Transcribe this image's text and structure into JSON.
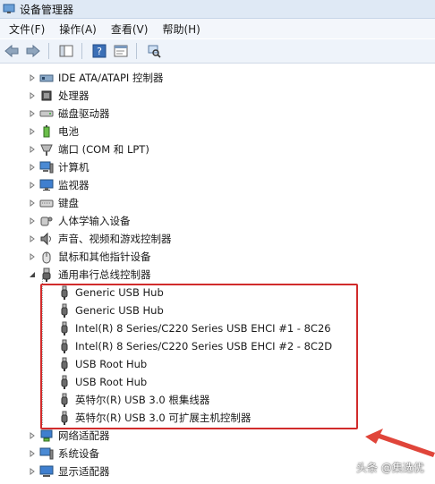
{
  "window": {
    "title": "设备管理器"
  },
  "menu": [
    "文件(F)",
    "操作(A)",
    "查看(V)",
    "帮助(H)"
  ],
  "tree": {
    "top_before": [
      {
        "label": "IDE ATA/ATAPI 控制器",
        "icon": "ide-controller-icon"
      },
      {
        "label": "处理器",
        "icon": "processor-icon"
      },
      {
        "label": "磁盘驱动器",
        "icon": "disk-drive-icon"
      },
      {
        "label": "电池",
        "icon": "battery-icon"
      },
      {
        "label": "端口 (COM 和 LPT)",
        "icon": "port-icon"
      },
      {
        "label": "计算机",
        "icon": "computer-icon"
      },
      {
        "label": "监视器",
        "icon": "monitor-icon"
      },
      {
        "label": "键盘",
        "icon": "keyboard-icon"
      },
      {
        "label": "人体学输入设备",
        "icon": "hid-icon"
      },
      {
        "label": "声音、视频和游戏控制器",
        "icon": "sound-icon"
      },
      {
        "label": "鼠标和其他指针设备",
        "icon": "mouse-icon"
      }
    ],
    "expanded": {
      "label": "通用串行总线控制器",
      "icon": "usb-controller-icon",
      "children": [
        "Generic USB Hub",
        "Generic USB Hub",
        "Intel(R) 8 Series/C220 Series USB EHCI #1 - 8C26",
        "Intel(R) 8 Series/C220 Series USB EHCI #2 - 8C2D",
        "USB Root Hub",
        "USB Root Hub",
        "英特尔(R) USB 3.0 根集线器",
        "英特尔(R) USB 3.0 可扩展主机控制器"
      ]
    },
    "top_after": [
      {
        "label": "网络适配器",
        "icon": "network-adapter-icon"
      },
      {
        "label": "系统设备",
        "icon": "system-device-icon"
      },
      {
        "label": "显示适配器",
        "icon": "display-adapter-icon"
      }
    ]
  },
  "watermark": "头条 @集选优",
  "colors": {
    "highlight": "#d12b2b",
    "arrow": "#e0453a"
  }
}
